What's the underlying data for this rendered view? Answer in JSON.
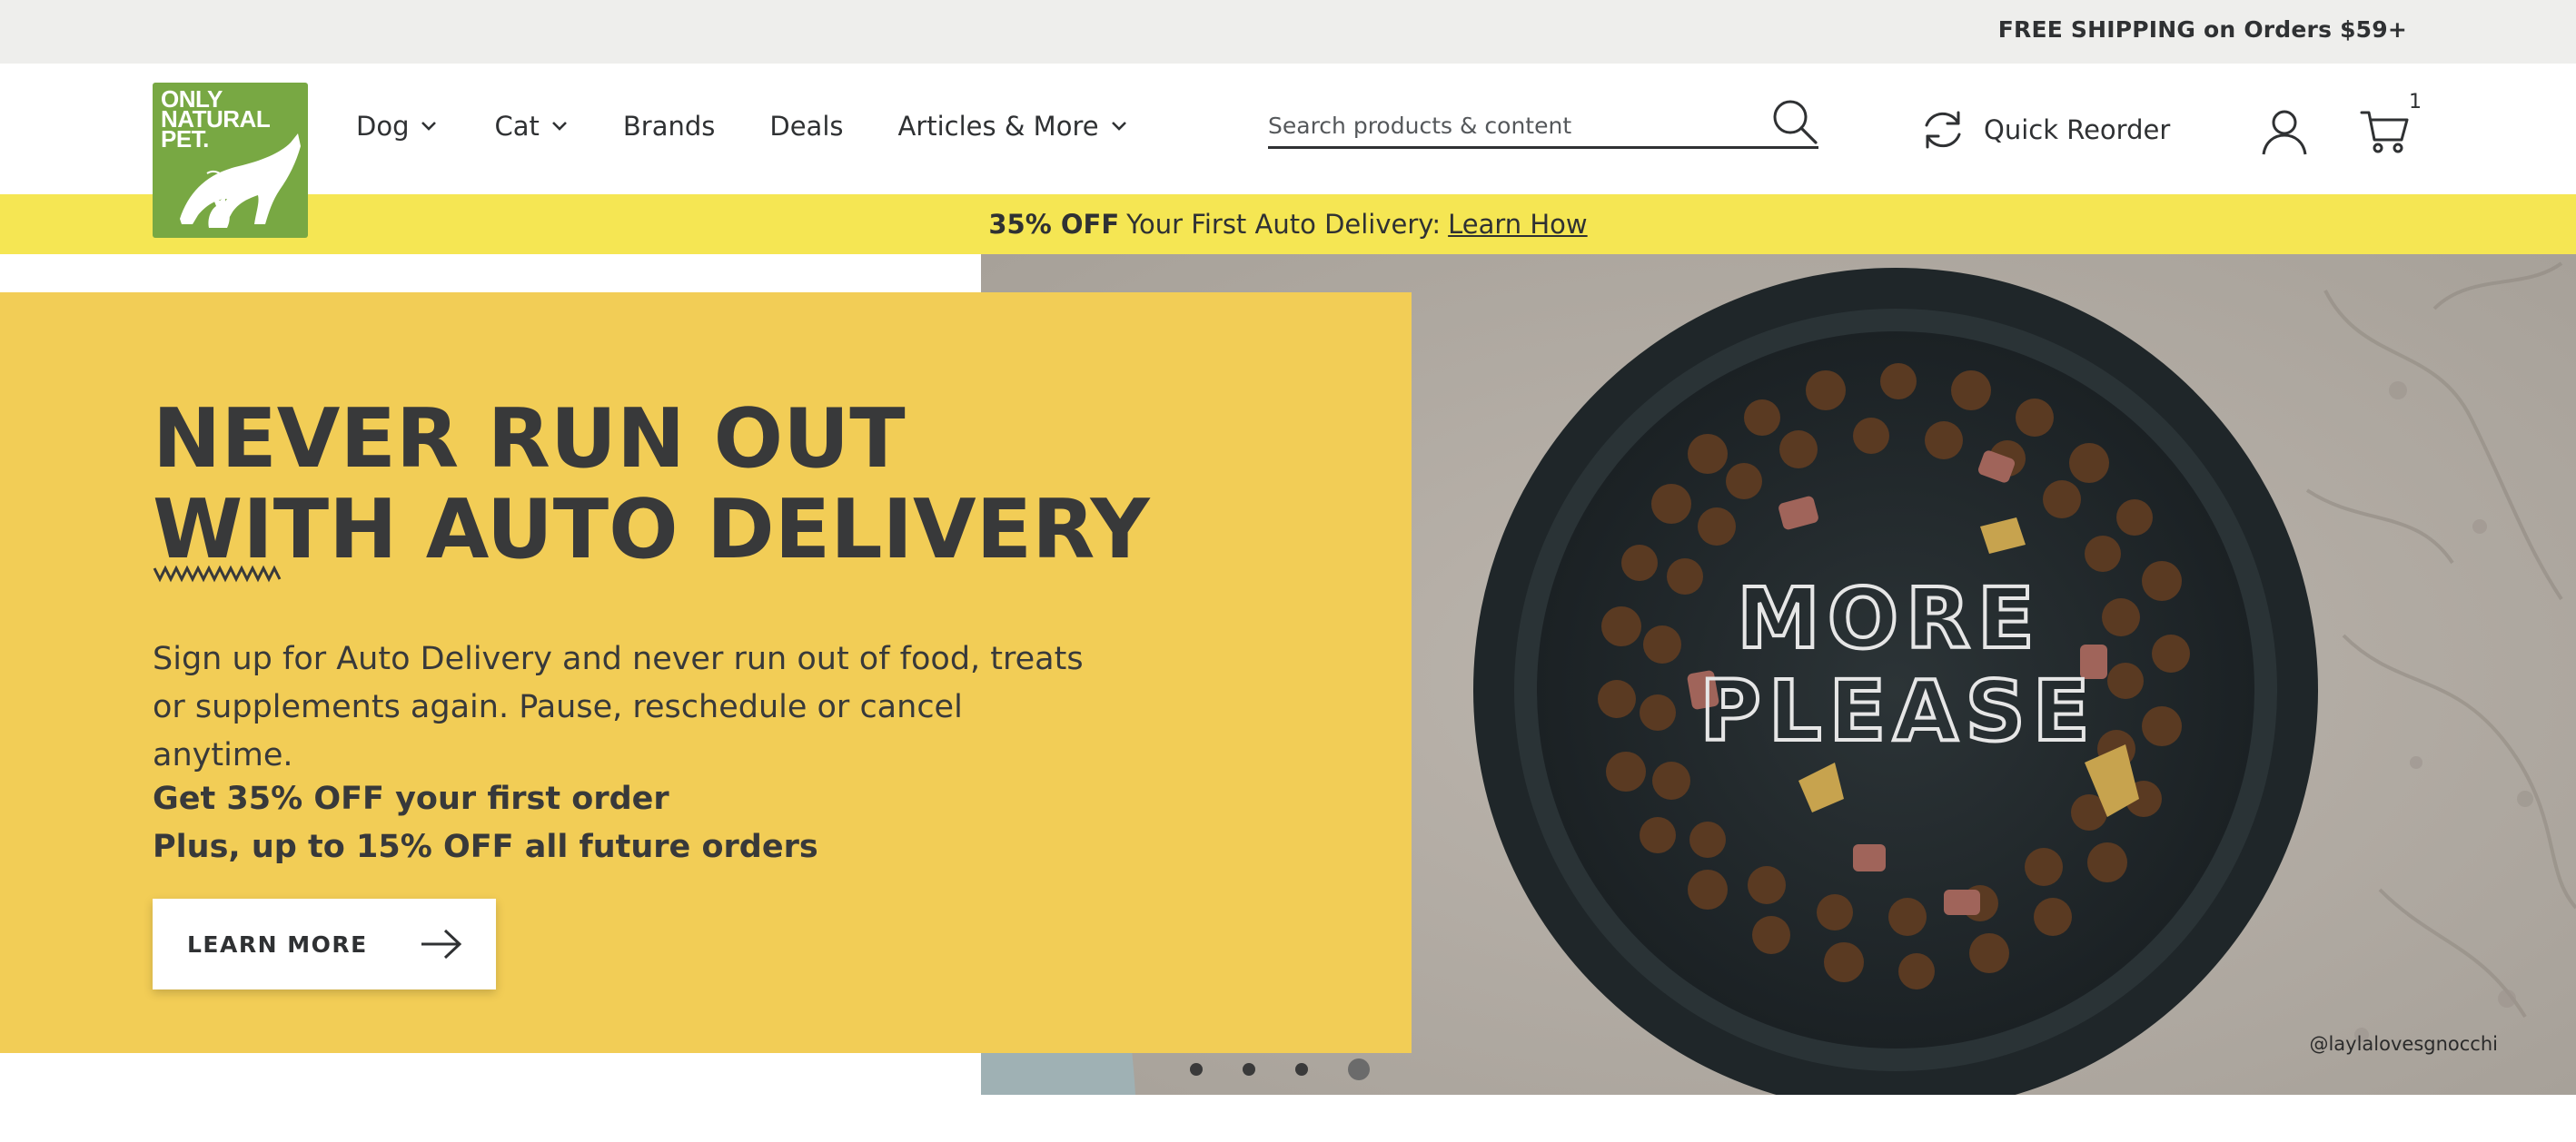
{
  "utility_bar": {
    "shipping_text": "FREE SHIPPING on Orders $59+"
  },
  "logo": {
    "line1": "ONLY",
    "line2": "NATURAL",
    "line3": "PET."
  },
  "nav": {
    "items": [
      {
        "label": "Dog",
        "has_dropdown": true
      },
      {
        "label": "Cat",
        "has_dropdown": true
      },
      {
        "label": "Brands",
        "has_dropdown": false
      },
      {
        "label": "Deals",
        "has_dropdown": false
      },
      {
        "label": "Articles & More",
        "has_dropdown": true
      }
    ]
  },
  "search": {
    "placeholder": "Search products & content",
    "value": "",
    "icon": "search-icon"
  },
  "quick_reorder": {
    "label": "Quick Reorder",
    "icon": "refresh-icon"
  },
  "account": {
    "icon": "user-icon"
  },
  "cart": {
    "icon": "cart-icon",
    "count": "1"
  },
  "promo": {
    "bold": "35% OFF",
    "text": "Your First Auto Delivery:",
    "link": "Learn How"
  },
  "hero": {
    "headline_line1": "NEVER RUN OUT",
    "headline_line2": "WITH AUTO DELIVERY",
    "description": "Sign up for Auto Delivery and never run out of food, treats or supplements again. Pause, reschedule or cancel anytime.",
    "offer_line1": "Get 35% OFF your first order",
    "offer_line2": "Plus, up to 15% OFF all future orders",
    "cta_label": "LEARN MORE",
    "bowl_text_line1": "MORE",
    "bowl_text_line2": "PLEASE",
    "photo_credit": "@laylalovesgnocchi",
    "carousel": {
      "slides": 4,
      "active": 4
    }
  },
  "colors": {
    "logo_green": "#78a843",
    "promo_yellow": "#f5e653",
    "hero_yellow": "#f2cd56",
    "text_dark": "#2f3133",
    "util_gray": "#eeeeec"
  }
}
